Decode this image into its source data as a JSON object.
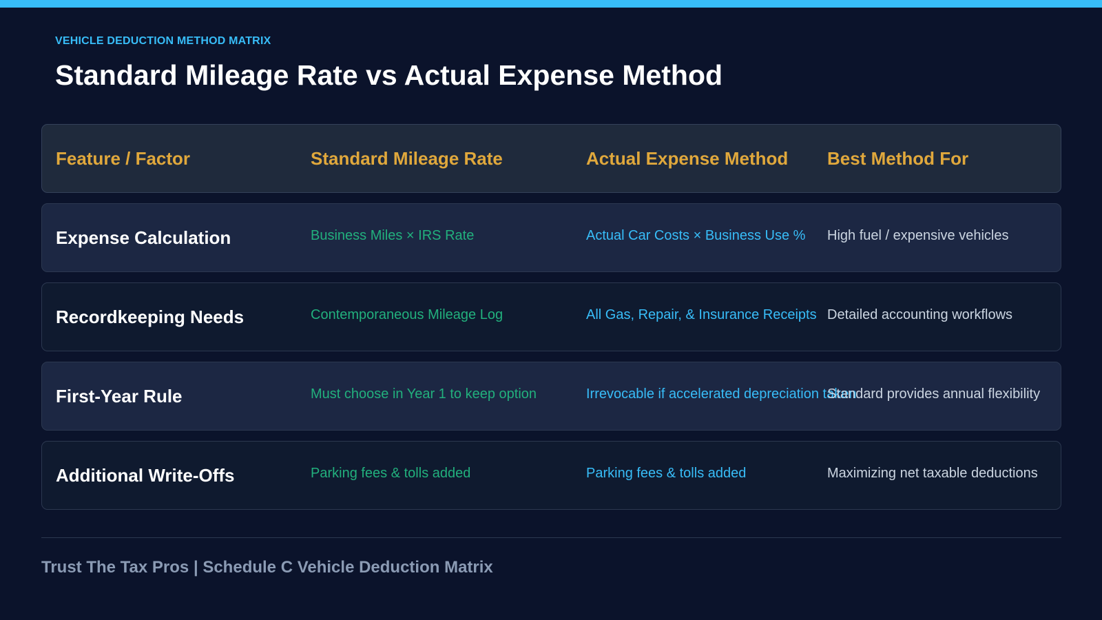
{
  "eyebrow": "VEHICLE DEDUCTION METHOD MATRIX",
  "title": "Standard Mileage Rate vs Actual Expense Method",
  "table": {
    "headers": [
      "Feature / Factor",
      "Standard Mileage Rate",
      "Actual Expense Method",
      "Best Method For"
    ],
    "rows": [
      {
        "feature": "Expense Calculation",
        "standard": "Business Miles × IRS Rate",
        "actual": "Actual Car Costs × Business Use %",
        "best": "High fuel / expensive vehicles"
      },
      {
        "feature": "Recordkeeping Needs",
        "standard": "Contemporaneous Mileage Log",
        "actual": "All Gas, Repair, & Insurance Receipts",
        "best": "Detailed accounting workflows"
      },
      {
        "feature": "First-Year Rule",
        "standard": "Must choose in Year 1 to keep option",
        "actual": "Irrevocable if accelerated depreciation taken",
        "best": "Standard provides annual flexibility"
      },
      {
        "feature": "Additional Write-Offs",
        "standard": "Parking fees & tolls added",
        "actual": "Parking fees & tolls added",
        "best": "Maximizing net taxable deductions"
      }
    ]
  },
  "footer": "Trust The Tax Pros | Schedule C Vehicle Deduction Matrix",
  "colors": {
    "accent": "#38bdf8",
    "header_text": "#e0a83c",
    "standard_text": "#22b07d",
    "background": "#0b132b"
  }
}
